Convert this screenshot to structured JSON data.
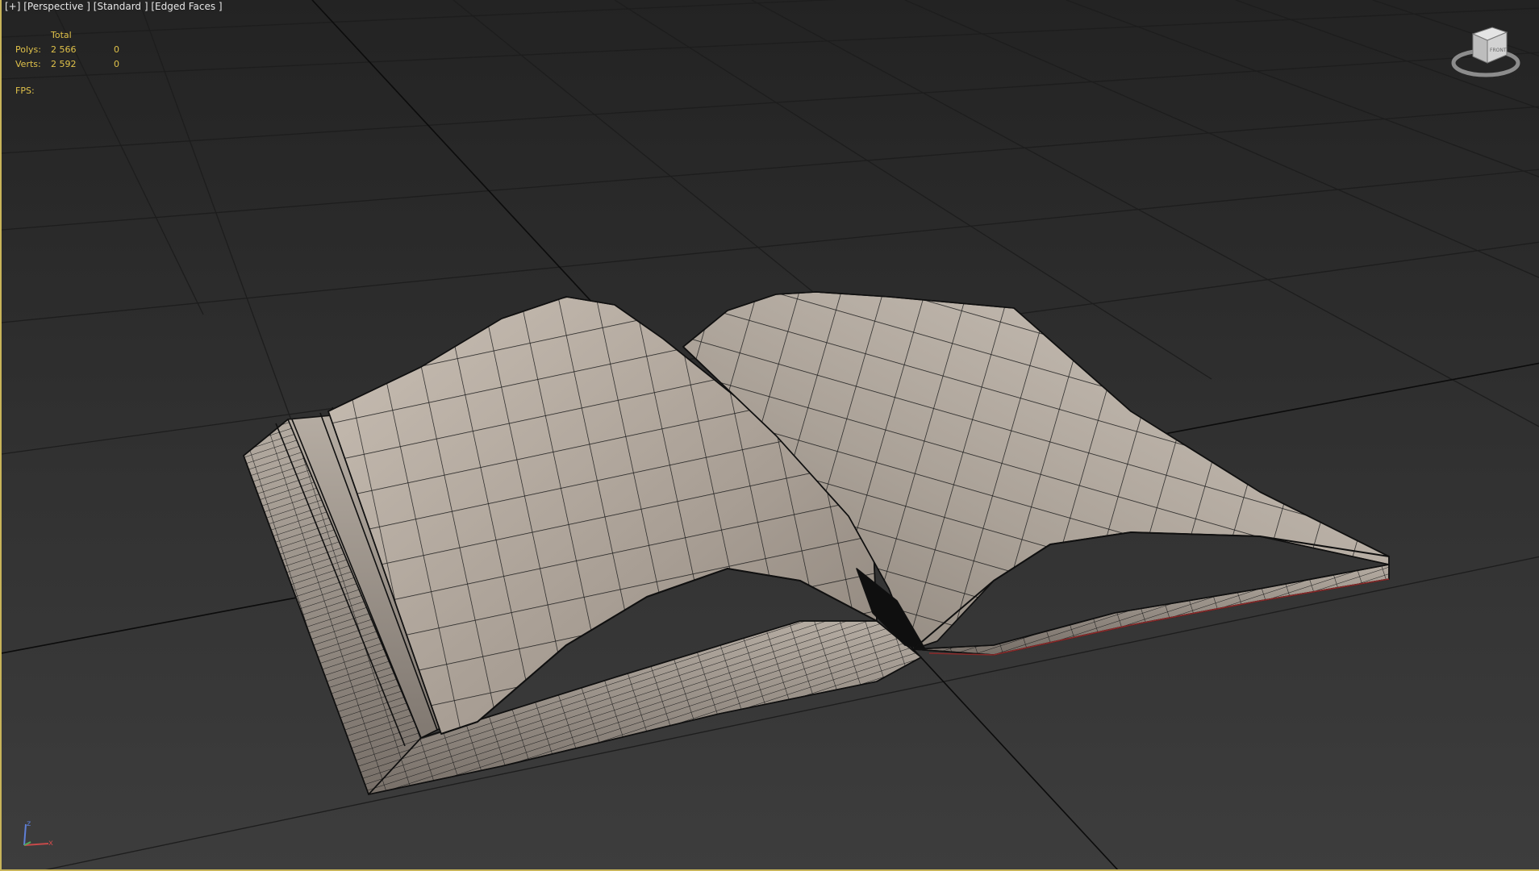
{
  "viewport": {
    "menu": {
      "plus": "[+]",
      "view": "[Perspective ]",
      "shading": "[Standard ]",
      "mode": "[Edged Faces ]"
    },
    "stats": {
      "header": "Total",
      "rows": [
        {
          "label": "Polys:",
          "total": "2 566",
          "selected": "0"
        },
        {
          "label": "Verts:",
          "total": "2 592",
          "selected": "0"
        }
      ],
      "fps_label": "FPS:"
    },
    "viewcube_label": "FRONT",
    "axis": {
      "x": "x",
      "z": "z"
    },
    "colors": {
      "viewport_border": "#c8b45a",
      "stats_text": "#e0c24a",
      "grid_line": "#1e1e1e",
      "page_fill": "#a89f95",
      "wire": "#111111"
    },
    "icons": [
      "viewcube-icon",
      "axis-tripod-icon",
      "book-mesh"
    ]
  }
}
